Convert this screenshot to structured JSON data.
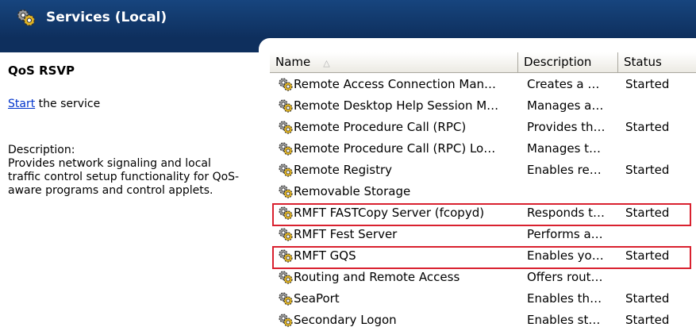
{
  "header": {
    "title": "Services (Local)",
    "icon": "gears-icon",
    "color": "#17457e"
  },
  "detail": {
    "service_name": "QoS RSVP",
    "start_link": "Start",
    "start_suffix": " the service",
    "description_label": "Description:",
    "description": "Provides network signaling and local\ntraffic control setup functionality for QoS-\naware programs and control applets."
  },
  "columns": {
    "name": "Name",
    "description": "Description",
    "status": "Status"
  },
  "highlight_color": "#d9212f",
  "services": [
    {
      "name": "Remote Access Connection Man…",
      "description": "Creates a …",
      "status": "Started",
      "highlighted": false
    },
    {
      "name": "Remote Desktop Help Session M…",
      "description": "Manages a…",
      "status": "",
      "highlighted": false
    },
    {
      "name": "Remote Procedure Call (RPC)",
      "description": "Provides th…",
      "status": "Started",
      "highlighted": false
    },
    {
      "name": "Remote Procedure Call (RPC) Lo…",
      "description": "Manages t…",
      "status": "",
      "highlighted": false
    },
    {
      "name": "Remote Registry",
      "description": "Enables re…",
      "status": "Started",
      "highlighted": false
    },
    {
      "name": "Removable Storage",
      "description": "",
      "status": "",
      "highlighted": false
    },
    {
      "name": "RMFT FASTCopy Server (fcopyd)",
      "description": "Responds t…",
      "status": "Started",
      "highlighted": true
    },
    {
      "name": "RMFT Fest Server",
      "description": "Performs a…",
      "status": "",
      "highlighted": false
    },
    {
      "name": "RMFT GQS",
      "description": "Enables yo…",
      "status": "Started",
      "highlighted": true
    },
    {
      "name": "Routing and Remote Access",
      "description": "Offers rout…",
      "status": "",
      "highlighted": false
    },
    {
      "name": "SeaPort",
      "description": "Enables th…",
      "status": "Started",
      "highlighted": false
    },
    {
      "name": "Secondary Logon",
      "description": "Enables st…",
      "status": "Started",
      "highlighted": false
    }
  ]
}
